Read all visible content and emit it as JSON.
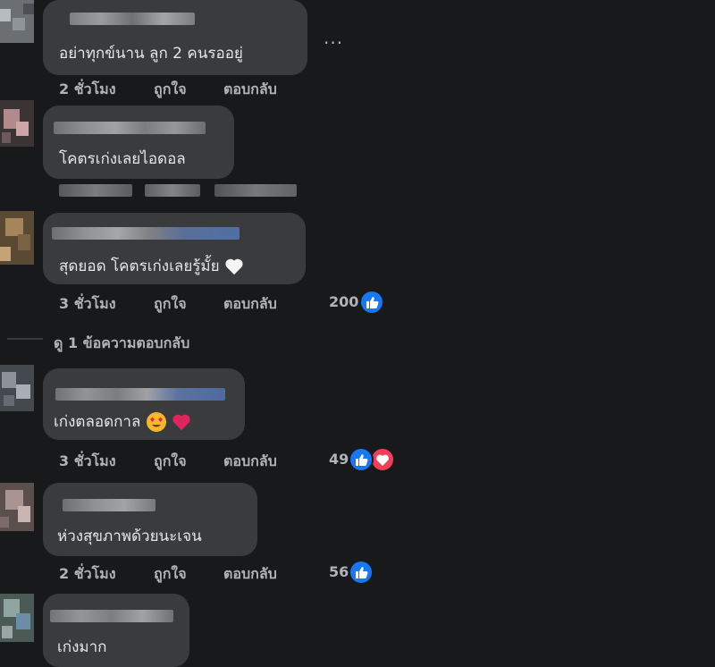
{
  "comments": [
    {
      "text": "อย่าทุกข์นาน ลูก 2 คนรออยู่",
      "time": "2 ชั่วโมง",
      "like": "ถูกใจ",
      "reply": "ตอบกลับ",
      "reactions": ""
    },
    {
      "text": "โคตรเก่งเลยไอดอล",
      "time": "",
      "like": "",
      "reply": "",
      "reactions": ""
    },
    {
      "text": "สุดยอด โคตรเก่งเลยรู้มั้ย",
      "emoji": "white-heart",
      "time": "3 ชั่วโมง",
      "like": "ถูกใจ",
      "reply": "ตอบกลับ",
      "reactions": "200"
    },
    {
      "text": "เก่งตลอดกาล",
      "emoji": "heart-eyes love",
      "time": "3 ชั่วโมง",
      "like": "ถูกใจ",
      "reply": "ตอบกลับ",
      "reactions": "49"
    },
    {
      "text": "ห่วงสุขภาพด้วยนะเจน",
      "time": "2 ชั่วโมง",
      "like": "ถูกใจ",
      "reply": "ตอบกลับ",
      "reactions": "56"
    },
    {
      "text": "เก่งมาก",
      "time": "",
      "like": "",
      "reply": "",
      "reactions": ""
    }
  ],
  "view_replies": "ดู 1 ข้อความตอบกลับ",
  "more_options": "...",
  "colors": {
    "background": "#18191a",
    "bubble": "#3a3b3c",
    "text": "#e4e6eb",
    "muted": "#b0b3b8",
    "like_blue": "#1877f2",
    "love_red": "#f33e58"
  }
}
